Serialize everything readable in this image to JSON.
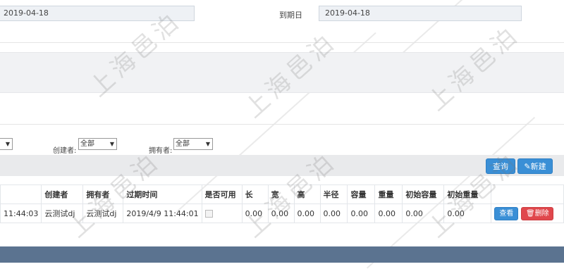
{
  "dates": {
    "start_value": "2019-04-18",
    "due_label": "到期日",
    "due_value": "2019-04-18"
  },
  "filters": {
    "creator_label": "创建者:",
    "creator_value": "全部",
    "owner_label": "拥有者:",
    "owner_value": "全部"
  },
  "toolbar": {
    "query_label": "查询",
    "new_label": "新建"
  },
  "table": {
    "headers": [
      "创建者",
      "拥有者",
      "过期时间",
      "是否可用",
      "长",
      "宽",
      "高",
      "半径",
      "容量",
      "重量",
      "初始容量",
      "初始重量"
    ],
    "rows": [
      {
        "time_fragment": "11:44:03",
        "creator": "云测试dj",
        "owner": "云测试dj",
        "expire": "2019/4/9 11:44:01",
        "length": "0.00",
        "width": "0.00",
        "height": "0.00",
        "radius": "0.00",
        "capacity": "0.00",
        "weight": "0.00",
        "init_capacity": "0.00",
        "init_weight": "0.00",
        "view_label": "查看",
        "delete_label": "删除"
      }
    ]
  },
  "watermark": "上海邑泊"
}
